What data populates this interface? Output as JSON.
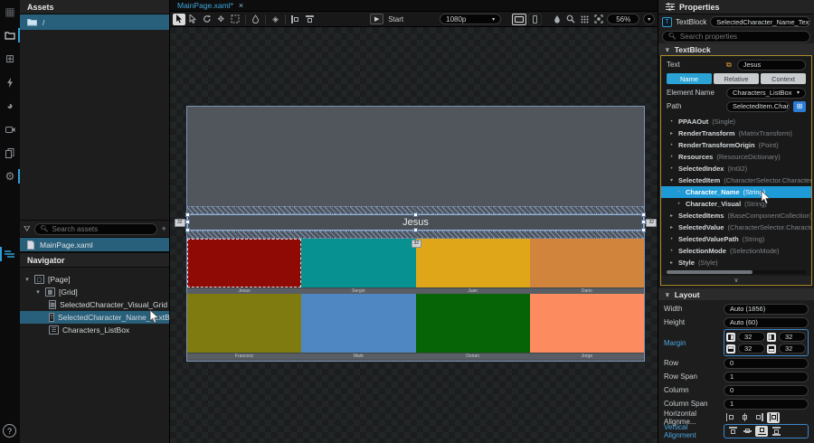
{
  "rail": {
    "help_label": "?"
  },
  "assets": {
    "title": "Assets",
    "root_folder": "/",
    "search_placeholder": "Search assets",
    "add_label": "+",
    "file": "MainPage.xaml"
  },
  "navigator": {
    "title": "Navigator",
    "items": [
      {
        "label": "[Page]"
      },
      {
        "label": "[Grid]"
      },
      {
        "label": "SelectedCharacter_Visual_Grid"
      },
      {
        "label": "SelectedCharacter_Name_TextBlock"
      },
      {
        "label": "Characters_ListBox"
      }
    ]
  },
  "tab": {
    "title": "MainPage.xaml*",
    "close": "×"
  },
  "toolbar": {
    "start": "Start",
    "resolution": "1080p",
    "zoom": "56%",
    "caret": "▾",
    "play": "▶"
  },
  "canvas": {
    "selected_text": "Jesus",
    "margin_left": "32",
    "margin_right": "32",
    "margin_bottom": "32",
    "tiles_row1": [
      {
        "name": "Jesus",
        "color": "#8f0a05"
      },
      {
        "name": "Sergio",
        "color": "#089191"
      },
      {
        "name": "Juan",
        "color": "#dfa61a"
      },
      {
        "name": "Dario",
        "color": "#d1853c"
      }
    ],
    "tiles_row2": [
      {
        "name": "Francesc",
        "color": "#7f7b10"
      },
      {
        "name": "Mark",
        "color": "#4f87c3"
      },
      {
        "name": "Dorian",
        "color": "#066406"
      },
      {
        "name": "Jorge",
        "color": "#fc8b60"
      }
    ]
  },
  "properties": {
    "title": "Properties",
    "type_label": "TextBlock",
    "name_value": "SelectedCharacter_Name_TextBlock",
    "search_placeholder": "Search properties",
    "section_textblock": "TextBlock",
    "text_label": "Text",
    "text_value": "Jesus",
    "tabs": [
      {
        "label": "Name"
      },
      {
        "label": "Relative"
      },
      {
        "label": "Context"
      }
    ],
    "element_name_label": "Element Name",
    "element_name_value": "Characters_ListBox",
    "path_label": "Path",
    "path_value": "SelectedItem.Character",
    "rows": [
      {
        "exp": "•",
        "name": "PPAAOut",
        "type": "(Single)"
      },
      {
        "exp": "▸",
        "name": "RenderTransform",
        "type": "(MatrixTransform)"
      },
      {
        "exp": "•",
        "name": "RenderTransformOrigin",
        "type": "(Point)"
      },
      {
        "exp": "•",
        "name": "Resources",
        "type": "(ResourceDictionary)"
      },
      {
        "exp": "•",
        "name": "SelectedIndex",
        "type": "(Int32)"
      },
      {
        "exp": "▾",
        "name": "SelectedItem",
        "type": "(CharacterSelector.Character_ViewM"
      },
      {
        "exp": "•",
        "name": "Character_Name",
        "type": "(String)"
      },
      {
        "exp": "•",
        "name": "Character_Visual",
        "type": "(String)"
      },
      {
        "exp": "▸",
        "name": "SelectedItems",
        "type": "(BaseComponentCollection)"
      },
      {
        "exp": "▸",
        "name": "SelectedValue",
        "type": "(CharacterSelector.Character_ViewM"
      },
      {
        "exp": "•",
        "name": "SelectedValuePath",
        "type": "(String)"
      },
      {
        "exp": "•",
        "name": "SelectionMode",
        "type": "(SelectionMode)"
      },
      {
        "exp": "▸",
        "name": "Style",
        "type": "(Style)"
      }
    ],
    "section_layout": "Layout",
    "layout": {
      "width_label": "Width",
      "width_value": "Auto (1856)",
      "height_label": "Height",
      "height_value": "Auto (60)",
      "margin_label": "Margin",
      "margin_values": [
        "32",
        "32",
        "32",
        "32"
      ],
      "row_label": "Row",
      "row_value": "0",
      "rowspan_label": "Row Span",
      "rowspan_value": "1",
      "column_label": "Column",
      "column_value": "0",
      "colspan_label": "Column Span",
      "colspan_value": "1",
      "halign_label": "Horizontal Alignme...",
      "valign_label": "Vertical Alignment"
    }
  }
}
